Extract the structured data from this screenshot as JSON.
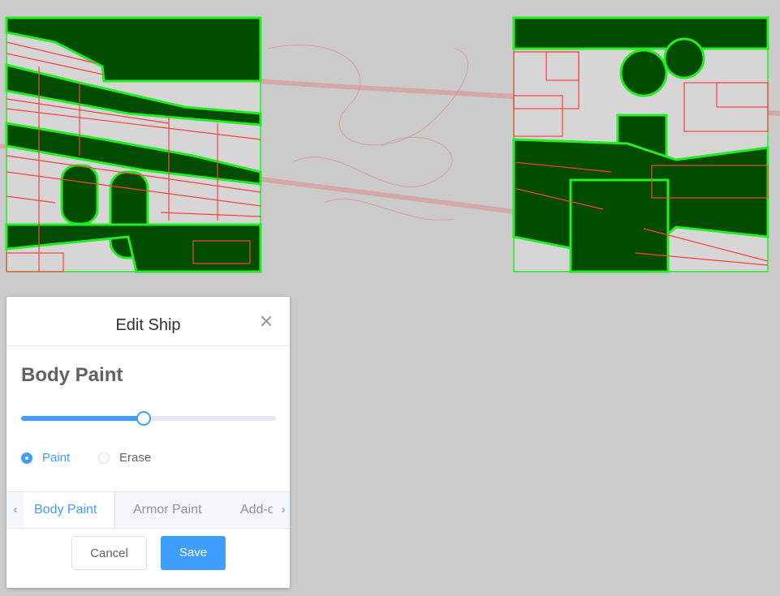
{
  "dialog": {
    "title": "Edit Ship",
    "panel_title": "Body Paint",
    "slider_value": 0.48,
    "radios": [
      {
        "label": "Paint",
        "checked": true
      },
      {
        "label": "Erase",
        "checked": false
      }
    ],
    "tabs": [
      "Body Paint",
      "Armor Paint",
      "Add-o"
    ],
    "active_tab": 0,
    "cancel_label": "Cancel",
    "save_label": "Save"
  },
  "icons": {
    "close": "close-icon",
    "tab_prev": "chevron-left-icon",
    "tab_next": "chevron-right-icon"
  },
  "colors": {
    "background": "#cbcbcb",
    "accent": "#409eff",
    "grid_red": "#ff3333",
    "hull_green": "#004d00",
    "outline_green": "#22ee22"
  }
}
